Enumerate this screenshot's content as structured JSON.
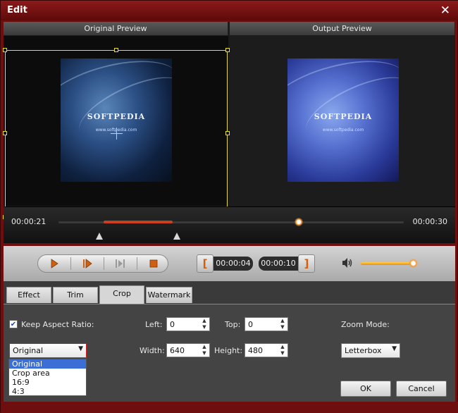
{
  "window": {
    "title": "Edit",
    "close_glyph": "✕"
  },
  "preview": {
    "original_label": "Original Preview",
    "output_label": "Output Preview",
    "logo_text": "SOFTPEDIA",
    "logo_url": "www.softpedia.com"
  },
  "timeline": {
    "start_time": "00:00:21",
    "end_time": "00:00:30"
  },
  "playback": {
    "mark_in_glyph": "[",
    "mark_out_glyph": "]",
    "start_mark_time": "00:00:04",
    "end_mark_time": "00:00:10",
    "volume_level": 0.88
  },
  "tabs": [
    {
      "label": "Effect",
      "active": false
    },
    {
      "label": "Trim",
      "active": false
    },
    {
      "label": "Crop",
      "active": true
    },
    {
      "label": "Watermark",
      "active": false
    }
  ],
  "crop": {
    "keep_aspect_label": "Keep Aspect Ratio:",
    "keep_aspect_checked": true,
    "left_label": "Left:",
    "left_value": "0",
    "top_label": "Top:",
    "top_value": "0",
    "width_label": "Width:",
    "width_value": "640",
    "height_label": "Height:",
    "height_value": "480",
    "zoom_mode_label": "Zoom Mode:",
    "zoom_mode_value": "Letterbox",
    "aspect_value": "Original",
    "aspect_options": [
      "Original",
      "Crop area",
      "16:9",
      "4:3"
    ]
  },
  "buttons": {
    "ok": "OK",
    "cancel": "Cancel"
  },
  "colors": {
    "accent": "#d06010",
    "frame": "#6e0e0e",
    "crop_box": "#e8e020"
  }
}
